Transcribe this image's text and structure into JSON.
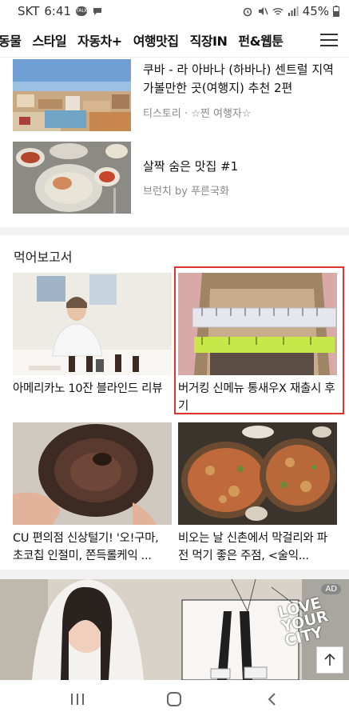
{
  "status_bar": {
    "carrier": "SKT",
    "time": "6:41",
    "talk_badge": "TALK",
    "battery": "45%"
  },
  "nav": {
    "tabs": [
      "동물",
      "스타일",
      "자동차+",
      "여행맛집",
      "직장IN",
      "펀&웹툰"
    ]
  },
  "articles": [
    {
      "title": "쿠바 - 라 아바나 (하바나) 센트럴 지역 가볼만한 곳(여행지) 추천 2편",
      "meta": "티스토리 · ☆찐 여행자☆"
    },
    {
      "title": "살짝 숨은 맛집 #1",
      "meta": "브런치 by 푸른국화"
    }
  ],
  "section": {
    "title": "먹어보고서",
    "cards": [
      {
        "title": "아메리카노 10잔 블라인드 리뷰"
      },
      {
        "title": "버거킹 신메뉴 통새우X 재출시 후기"
      },
      {
        "title": "CU 편의점 신상털기! '오!구마, 초코칩 인절미, 쫀득롤케익 ..."
      },
      {
        "title": "비오는 날 신촌에서 막걸리와 파전 먹기 좋은 주점, <술익..."
      }
    ]
  },
  "ad": {
    "badge": "AD",
    "logo_lines": [
      "LOVE",
      "YOUR",
      "CITY"
    ]
  },
  "colors": {
    "highlight_border": "#dd3333",
    "separator": "#f2f2f2"
  },
  "icons": {
    "hamburger": "menu-icon",
    "scroll_top": "arrow-up-icon",
    "recents": "recents-icon",
    "home": "home-icon",
    "back": "back-icon"
  }
}
